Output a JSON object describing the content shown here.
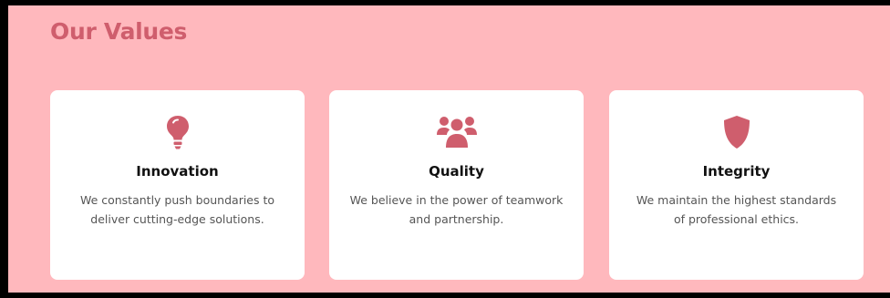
{
  "section": {
    "title": "Our Values"
  },
  "colors": {
    "background": "#ffb8bd",
    "accent": "#cf5e6d",
    "card": "#ffffff"
  },
  "cards": [
    {
      "icon": "lightbulb-icon",
      "title": "Innovation",
      "text": "We constantly push boundaries to deliver cutting-edge solutions."
    },
    {
      "icon": "users-icon",
      "title": "Quality",
      "text": "We believe in the power of teamwork and partnership."
    },
    {
      "icon": "shield-icon",
      "title": "Integrity",
      "text": "We maintain the highest standards of professional ethics."
    }
  ]
}
